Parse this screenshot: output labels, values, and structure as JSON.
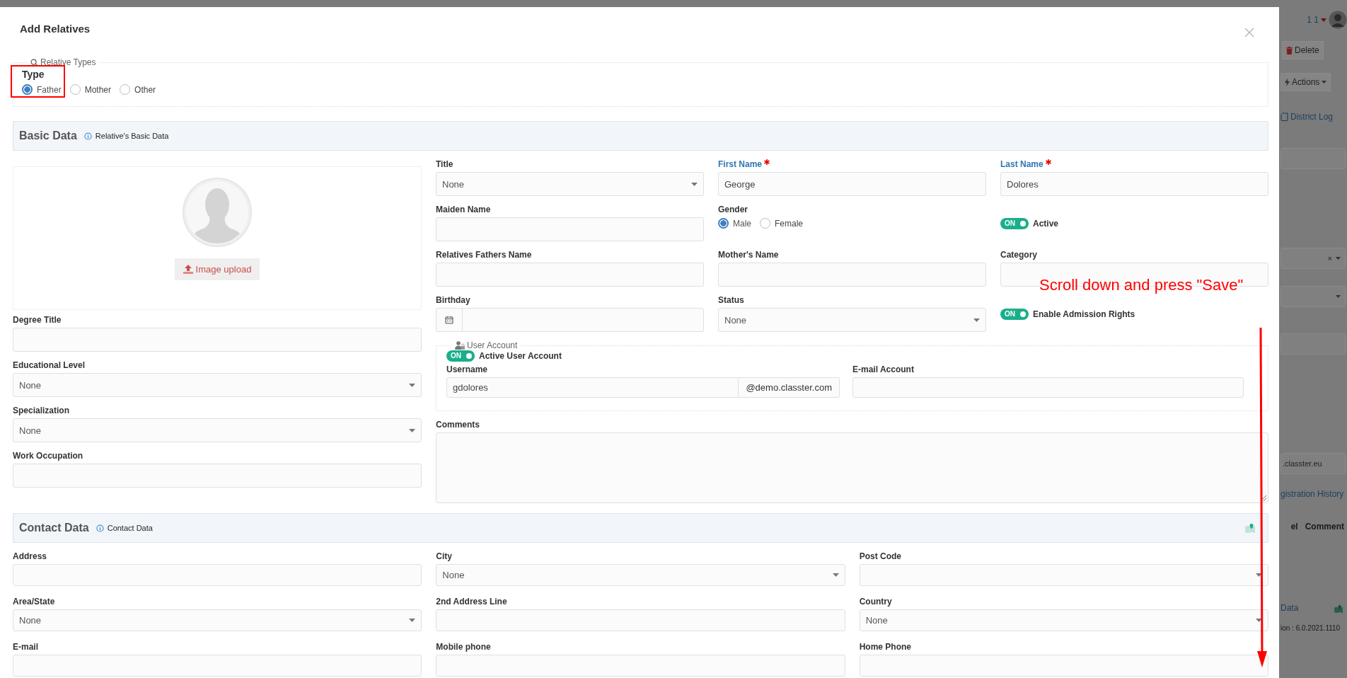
{
  "modal": {
    "title": "Add Relatives"
  },
  "relative_types": {
    "legend": "Relative Types",
    "label": "Type",
    "options": [
      {
        "label": "Father",
        "selected": true
      },
      {
        "label": "Mother",
        "selected": false
      },
      {
        "label": "Other",
        "selected": false
      }
    ]
  },
  "basic_data": {
    "title": "Basic Data",
    "info": "Relative's Basic Data",
    "image_upload": "Image upload",
    "left_fields": [
      {
        "kind": "input",
        "label": "Degree Title"
      },
      {
        "kind": "select",
        "label": "Educational Level",
        "value": "None"
      },
      {
        "kind": "select",
        "label": "Specialization",
        "value": "None"
      },
      {
        "kind": "input",
        "label": "Work Occupation"
      }
    ],
    "fields": [
      {
        "kind": "select",
        "label": "Title",
        "value": "None"
      },
      {
        "kind": "input",
        "label": "First Name",
        "required": true,
        "value": "George"
      },
      {
        "kind": "input",
        "label": "Last Name",
        "required": true,
        "value": "Dolores"
      },
      {
        "kind": "input",
        "label": "Maiden Name"
      },
      {
        "kind": "radio",
        "label": "Gender",
        "options": [
          {
            "label": "Male",
            "selected": true
          },
          {
            "label": "Female",
            "selected": false
          }
        ]
      },
      {
        "kind": "toggle",
        "label": "Active",
        "on": true,
        "toggle_text": "ON"
      },
      {
        "kind": "input",
        "label": "Relatives Fathers Name"
      },
      {
        "kind": "input",
        "label": "Mother's Name"
      },
      {
        "kind": "input",
        "label": "Category"
      },
      {
        "kind": "date",
        "label": "Birthday"
      },
      {
        "kind": "select",
        "label": "Status",
        "value": "None"
      },
      {
        "kind": "toggle",
        "label": "Enable Admission Rights",
        "on": true,
        "toggle_text": "ON"
      }
    ],
    "user_account": {
      "legend": "User Account",
      "active": {
        "label": "Active User Account",
        "on": true,
        "toggle_text": "ON"
      },
      "username": {
        "label": "Username",
        "value": "gdolores",
        "suffix": "@demo.classter.com"
      },
      "email": {
        "label": "E-mail Account"
      }
    },
    "comments": {
      "label": "Comments"
    }
  },
  "contact_data": {
    "title": "Contact Data",
    "info": "Contact Data",
    "fields": [
      {
        "kind": "input",
        "label": "Address"
      },
      {
        "kind": "select",
        "label": "City",
        "value": "None"
      },
      {
        "kind": "select",
        "label": "Post Code"
      },
      {
        "kind": "select",
        "label": "Area/State",
        "value": "None"
      },
      {
        "kind": "input",
        "label": "2nd Address Line"
      },
      {
        "kind": "select",
        "label": "Country",
        "value": "None"
      },
      {
        "kind": "input",
        "label": "E-mail"
      },
      {
        "kind": "input",
        "label": "Mobile phone"
      },
      {
        "kind": "input",
        "label": "Home Phone"
      }
    ]
  },
  "annotation": {
    "text": "Scroll down and press \"Save\""
  },
  "background_page": {
    "user_count": "1 1",
    "delete": "Delete",
    "actions": "Actions",
    "district_log": "District Log",
    "clear_mark": "×",
    "email_suffix": ".classter.eu",
    "registration_history": "gistration History",
    "columns": [
      "el",
      "Comment"
    ],
    "data_link": "Data",
    "version": "ion : 6.0.2021.1110"
  }
}
